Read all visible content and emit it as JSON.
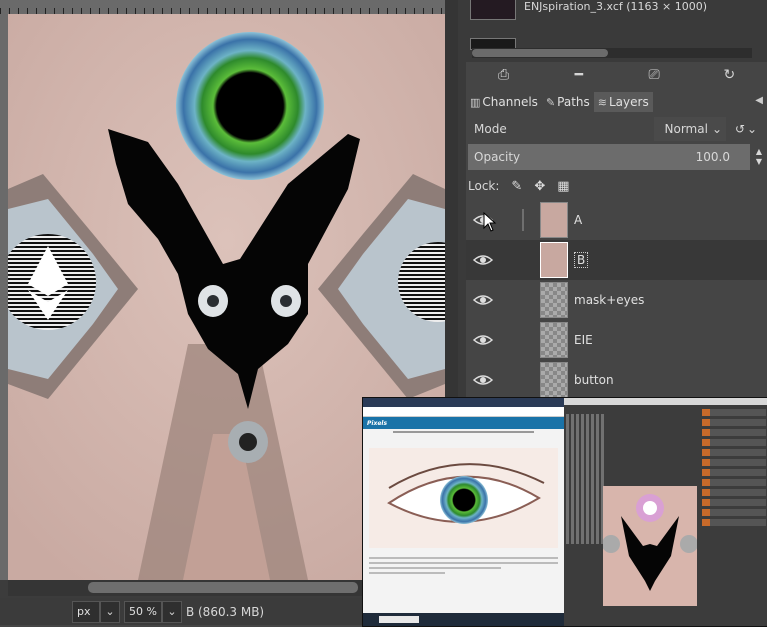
{
  "image_window": {
    "units": "px",
    "zoom": "50 %",
    "status_text": "B (860.3 MB)"
  },
  "images_panel": {
    "items": [
      {
        "name": "ENJspiration_3.xcf (1163 × 1000)"
      }
    ]
  },
  "dock_tabs": [
    {
      "label": "Channels",
      "icon": "channels-icon"
    },
    {
      "label": "Paths",
      "icon": "paths-icon"
    },
    {
      "label": "Layers",
      "icon": "layers-icon"
    }
  ],
  "layers_panel": {
    "mode_label": "Mode",
    "mode_value": "Normal",
    "opacity_label": "Opacity",
    "opacity_value": "100.0",
    "lock_label": "Lock:",
    "layers": [
      {
        "name": "A",
        "visible": true
      },
      {
        "name": "B",
        "visible": true
      },
      {
        "name": "mask+eyes",
        "visible": true
      },
      {
        "name": "EIE",
        "visible": true
      },
      {
        "name": "button",
        "visible": true
      }
    ]
  },
  "overlay": {
    "site_name": "Pixels"
  },
  "colors": {
    "panel_bg": "#454545",
    "skin": "#d7b9b1",
    "iris_green": "#3f9b2b",
    "mask_black": "#050505"
  }
}
